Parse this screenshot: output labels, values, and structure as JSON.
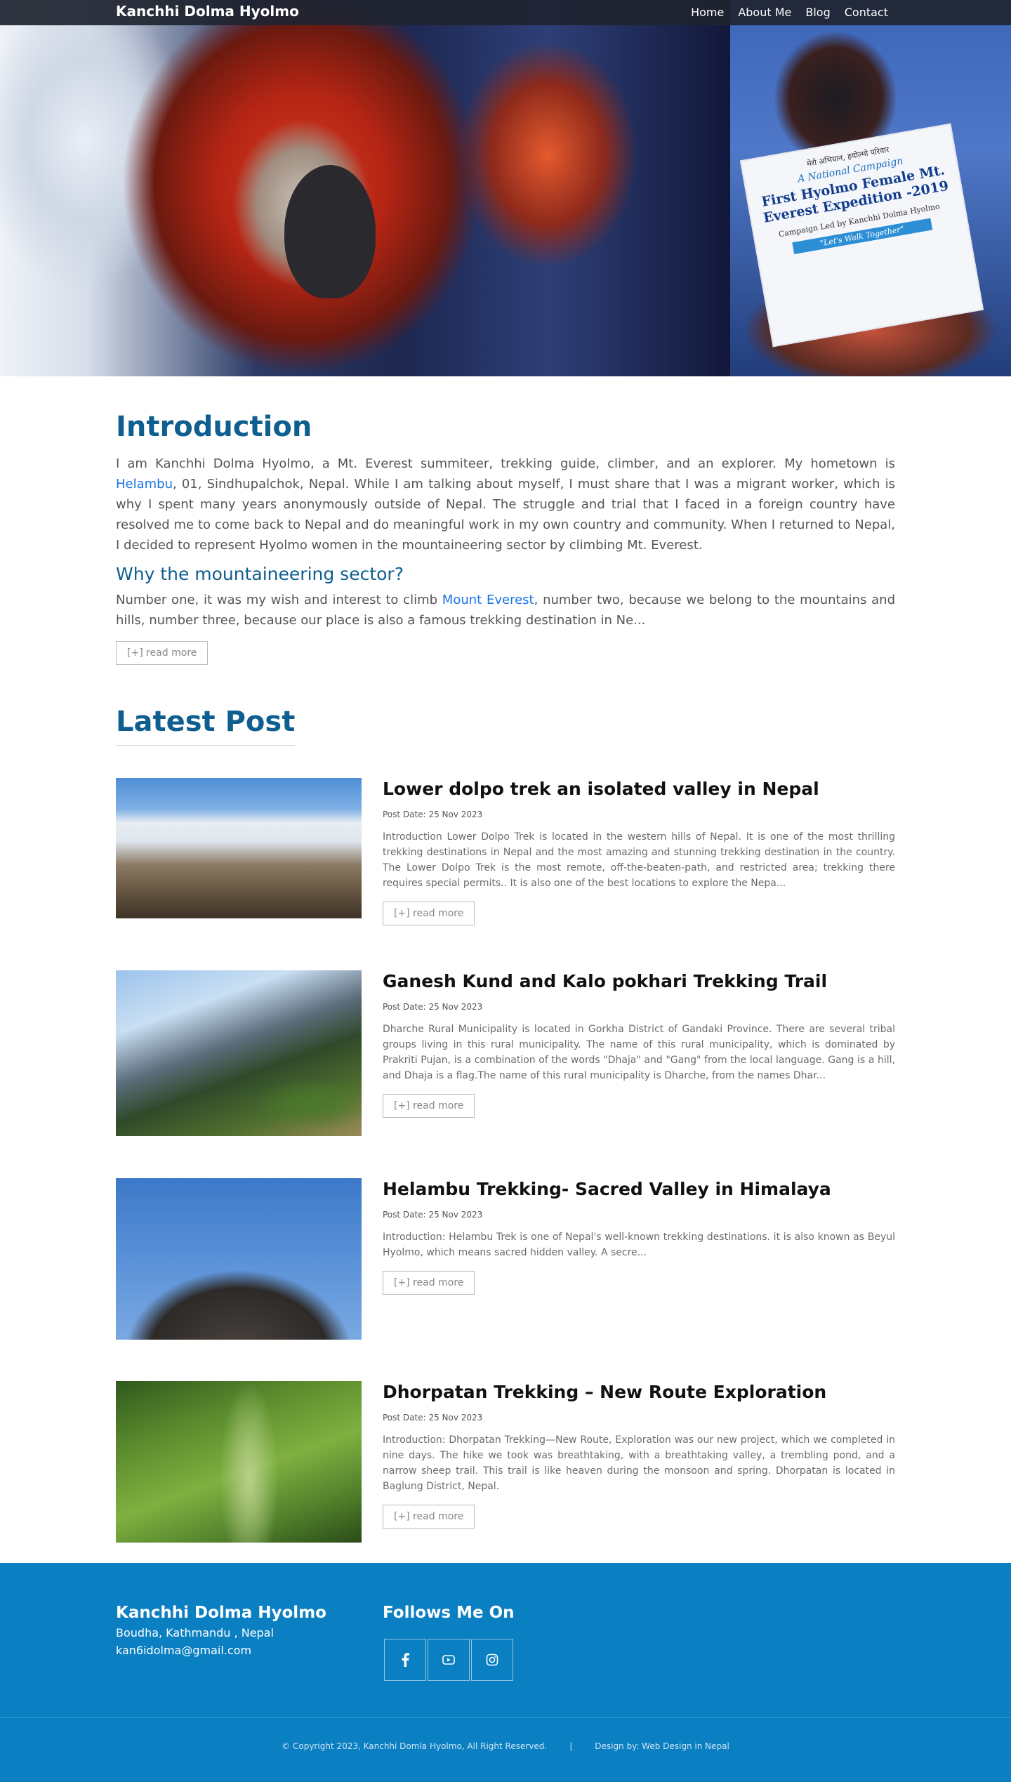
{
  "nav": {
    "brand": "Kanchhi Dolma Hyolmo",
    "links": [
      "Home",
      "About Me",
      "Blog",
      "Contact"
    ]
  },
  "hero": {
    "banner": {
      "line1": "मेरो अभियान, हयोल्मो परिवार",
      "line2": "A National Campaign",
      "line3": "First Hyolmo Female Mt. Everest Expedition -2019",
      "line4": "Campaign Led by Kanchhi Dolma Hyolmo",
      "line5": "\"Let's Walk Together\""
    }
  },
  "intro": {
    "heading": "Introduction",
    "p1_before": "I am Kanchhi Dolma Hyolmo, a Mt. Everest summiteer, trekking guide, climber, and an explorer. My hometown is ",
    "p1_link": "Helambu",
    "p1_after": ", 01, Sindhupalchok, Nepal. While I am talking about myself, I must share that I was a migrant worker, which is why I spent many years anonymously outside of Nepal. The struggle and trial that I faced in a foreign country have resolved me to come back to Nepal and do meaningful work in my own country and community. When I returned to Nepal, I decided to represent Hyolmo women in the mountaineering sector by climbing Mt. Everest.",
    "subheading": "Why the mountaineering sector?",
    "p2_before": "Number one, it was my wish and interest to climb ",
    "p2_link": "Mount Everest",
    "p2_after": ", number two, because we belong to the mountains and hills, number three, because our place is also a famous trekking destination in Ne...",
    "read_more": "[+] read more"
  },
  "latest": {
    "heading": "Latest Post",
    "posts": [
      {
        "title": "Lower dolpo trek an isolated valley in Nepal",
        "date": "Post Date: 25 Nov 2023",
        "desc": "Introduction Lower Dolpo Trek is located in the western hills of Nepal. It is one of the most thrilling trekking destinations in Nepal and the most amazing and stunning trekking destination in the country. The Lower Dolpo Trek is the most remote, off-the-beaten-path, and restricted area; trekking there requires special permits.. It is also one of the best locations to explore the Nepa...",
        "read_more": "[+] read more"
      },
      {
        "title": "Ganesh Kund and Kalo pokhari Trekking Trail",
        "date": "Post Date: 25 Nov 2023",
        "desc": "Dharche Rural Municipality is located in Gorkha District of Gandaki Province. There are several tribal groups living in this rural municipality. The name of this rural municipality, which is dominated by Prakriti Pujan, is a combination of the words \"Dhaja\" and \"Gang\" from the local language. Gang is a hill, and Dhaja is a flag.The name of this rural municipality is Dharche, from the names Dhar...",
        "read_more": "[+] read more"
      },
      {
        "title": "Helambu Trekking- Sacred Valley in Himalaya",
        "date": "Post Date: 25 Nov 2023",
        "desc": "Introduction:  Helambu Trek is one of Nepal's well-known trekking destinations. it  is also known as Beyul Hyolmo, which means sacred hidden valley. A secre...",
        "read_more": "[+] read more"
      },
      {
        "title": "Dhorpatan Trekking – New Route Exploration",
        "date": "Post Date: 25 Nov 2023",
        "desc": "Introduction: Dhorpatan Trekking—New Route, Exploration was our new project, which we completed in nine days. The hike we took was breathtaking, with a breathtaking valley, a trembling pond, and a narrow sheep trail. This trail is like heaven during the monsoon and spring. Dhorpatan is located in Baglung District, Nepal.",
        "read_more": "[+] read more"
      }
    ]
  },
  "footer": {
    "name": "Kanchhi Dolma Hyolmo",
    "address": "Boudha, Kathmandu , Nepal",
    "email": "kan6idolma@gmail.com",
    "follow_heading": "Follows Me On",
    "social": [
      "facebook-icon",
      "youtube-icon",
      "instagram-icon"
    ],
    "copyright": "© Copyright 2023, Kanchhi Domla Hyolmo, All Right Reserved.",
    "separator": "|",
    "design_by": "Design by: Web Design in Nepal"
  },
  "colors": {
    "heading": "#0e5f8f",
    "link": "#1a73e8",
    "footer_bg": "#0a7fc1"
  }
}
